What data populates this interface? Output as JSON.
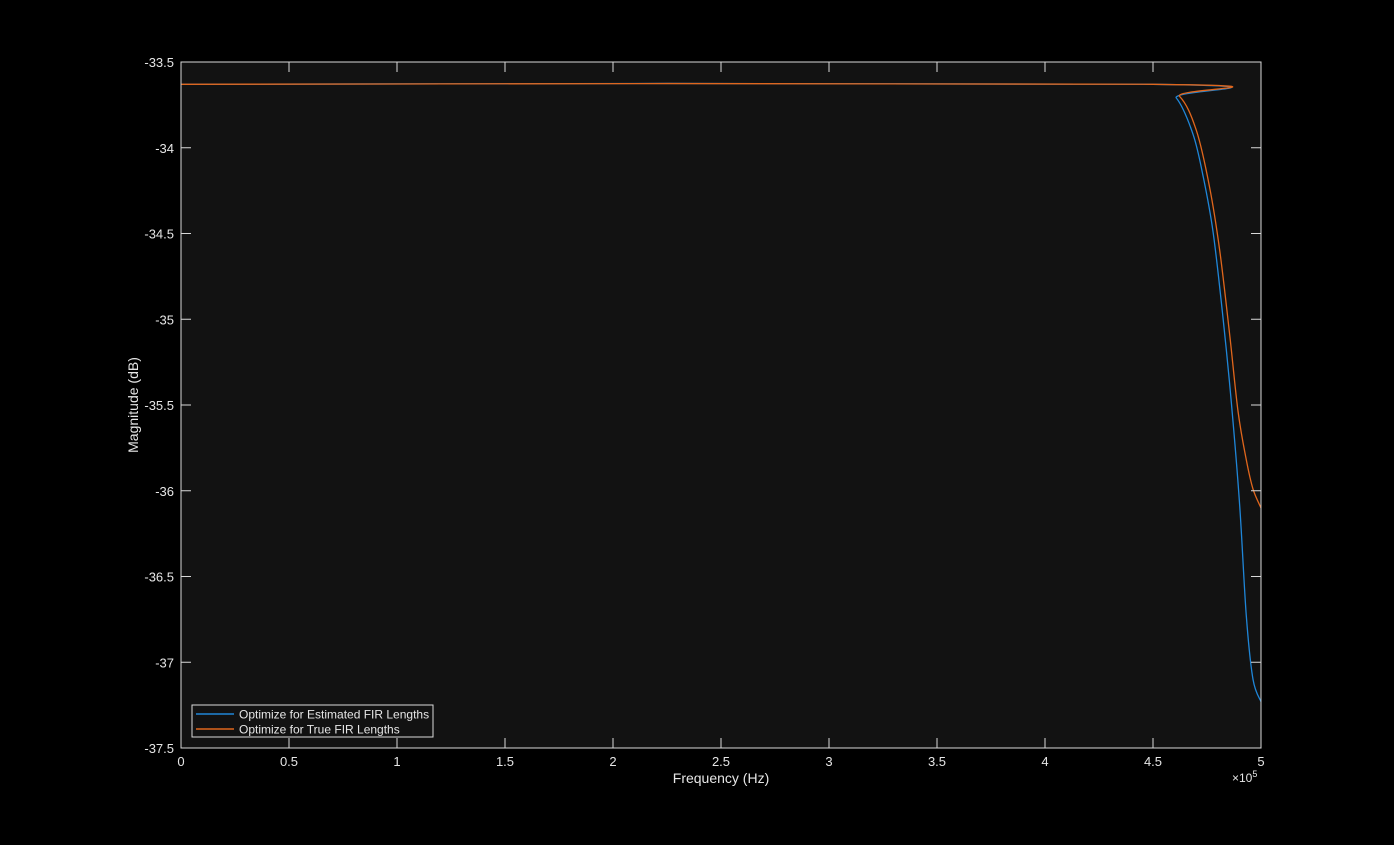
{
  "chart_data": {
    "type": "line",
    "title": "",
    "xlabel": "Frequency (Hz)",
    "ylabel": "Magnitude (dB)",
    "x_exponent_label": "×10",
    "x_exponent_power": "5",
    "xlim": [
      0,
      5
    ],
    "ylim": [
      -37.5,
      -33.5
    ],
    "xticks": [
      0,
      0.5,
      1,
      1.5,
      2,
      2.5,
      3,
      3.5,
      4,
      4.5,
      5
    ],
    "xtick_labels": [
      "0",
      "0.5",
      "1",
      "1.5",
      "2",
      "2.5",
      "3",
      "3.5",
      "4",
      "4.5",
      "5"
    ],
    "yticks": [
      -33.5,
      -34,
      -34.5,
      -35,
      -35.5,
      -36,
      -36.5,
      -37,
      -37.5
    ],
    "ytick_labels": [
      "-33.5",
      "-34",
      "-34.5",
      "-35",
      "-35.5",
      "-36",
      "-36.5",
      "-37",
      "-37.5"
    ],
    "grid": false,
    "legend_placement": "bottom-left",
    "series": [
      {
        "name": "Optimize for Estimated FIR Lengths",
        "color": "#1f86d8",
        "x": [
          0,
          4.5,
          4.608,
          4.685,
          4.731,
          4.778,
          4.824,
          4.863,
          4.901,
          4.932,
          4.963,
          5.0
        ],
        "y": [
          -33.63,
          -33.63,
          -33.71,
          -33.92,
          -34.16,
          -34.49,
          -34.99,
          -35.49,
          -36.08,
          -36.73,
          -37.1,
          -37.23
        ]
      },
      {
        "name": "Optimize for True FIR Lengths",
        "color": "#e0661c",
        "x": [
          0,
          4.5,
          4.623,
          4.701,
          4.762,
          4.809,
          4.855,
          4.894,
          4.932,
          4.963,
          5.0
        ],
        "y": [
          -33.63,
          -33.63,
          -33.7,
          -33.9,
          -34.23,
          -34.6,
          -35.09,
          -35.54,
          -35.82,
          -35.99,
          -36.1
        ]
      }
    ]
  }
}
